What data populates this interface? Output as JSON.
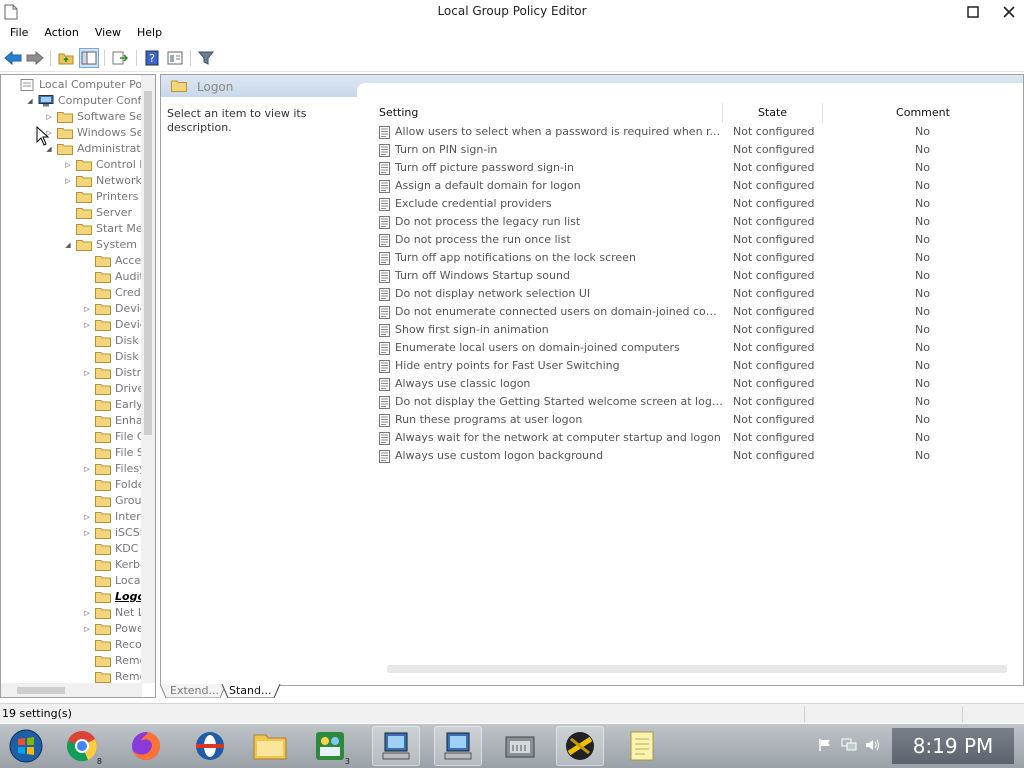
{
  "window": {
    "title": "Local Group Policy Editor",
    "maximize_glyph": "☐",
    "close_glyph": "✕"
  },
  "menu": [
    "File",
    "Action",
    "View",
    "Help"
  ],
  "toolbar": {
    "icons": [
      "back-arrow-icon",
      "forward-arrow-icon",
      "up-folder-icon",
      "show-hide-tree-icon",
      "export-list-icon",
      "help-icon",
      "properties-icon",
      "filter-icon"
    ]
  },
  "tree": {
    "nodes": [
      {
        "label": "Local Computer Polic",
        "indent": 0,
        "arrow": "",
        "icon": "policy"
      },
      {
        "label": "Computer Configu",
        "indent": 1,
        "arrow": "◢",
        "icon": "computer"
      },
      {
        "label": "Software Setti",
        "indent": 2,
        "arrow": "▷",
        "icon": "folder"
      },
      {
        "label": "Windows Setti",
        "indent": 2,
        "arrow": "▷",
        "icon": "folder"
      },
      {
        "label": "Administrative",
        "indent": 2,
        "arrow": "◢",
        "icon": "folder"
      },
      {
        "label": "Control Pa",
        "indent": 3,
        "arrow": "▷",
        "icon": "folder"
      },
      {
        "label": "Network",
        "indent": 3,
        "arrow": "▷",
        "icon": "folder"
      },
      {
        "label": "Printers",
        "indent": 3,
        "arrow": "",
        "icon": "folder"
      },
      {
        "label": "Server",
        "indent": 3,
        "arrow": "",
        "icon": "folder"
      },
      {
        "label": "Start Menu",
        "indent": 3,
        "arrow": "",
        "icon": "folder"
      },
      {
        "label": "System",
        "indent": 3,
        "arrow": "◢",
        "icon": "folder"
      },
      {
        "label": "Access",
        "indent": 4,
        "arrow": "",
        "icon": "folder"
      },
      {
        "label": "Audit P",
        "indent": 4,
        "arrow": "",
        "icon": "folder"
      },
      {
        "label": "Creden",
        "indent": 4,
        "arrow": "",
        "icon": "folder"
      },
      {
        "label": "Device",
        "indent": 4,
        "arrow": "▷",
        "icon": "folder"
      },
      {
        "label": "Device",
        "indent": 4,
        "arrow": "▷",
        "icon": "folder"
      },
      {
        "label": "Disk N\\",
        "indent": 4,
        "arrow": "",
        "icon": "folder"
      },
      {
        "label": "Disk Q",
        "indent": 4,
        "arrow": "",
        "icon": "folder"
      },
      {
        "label": "Distrib",
        "indent": 4,
        "arrow": "▷",
        "icon": "folder"
      },
      {
        "label": "Driver I",
        "indent": 4,
        "arrow": "",
        "icon": "folder"
      },
      {
        "label": "Early La",
        "indent": 4,
        "arrow": "",
        "icon": "folder"
      },
      {
        "label": "Enhanc",
        "indent": 4,
        "arrow": "",
        "icon": "folder"
      },
      {
        "label": "File Cla",
        "indent": 4,
        "arrow": "",
        "icon": "folder"
      },
      {
        "label": "File Sh",
        "indent": 4,
        "arrow": "",
        "icon": "folder"
      },
      {
        "label": "Filesys",
        "indent": 4,
        "arrow": "▷",
        "icon": "folder"
      },
      {
        "label": "Folder",
        "indent": 4,
        "arrow": "",
        "icon": "folder"
      },
      {
        "label": "Group",
        "indent": 4,
        "arrow": "",
        "icon": "folder"
      },
      {
        "label": "Interne",
        "indent": 4,
        "arrow": "▷",
        "icon": "folder"
      },
      {
        "label": "iSCSI",
        "indent": 4,
        "arrow": "▷",
        "icon": "folder"
      },
      {
        "label": "KDC",
        "indent": 4,
        "arrow": "",
        "icon": "folder"
      },
      {
        "label": "Kerbero",
        "indent": 4,
        "arrow": "",
        "icon": "folder"
      },
      {
        "label": "Locale",
        "indent": 4,
        "arrow": "",
        "icon": "folder"
      },
      {
        "label": "Logon",
        "indent": 4,
        "arrow": "",
        "icon": "folder",
        "selected": true
      },
      {
        "label": "Net Log",
        "indent": 4,
        "arrow": "▷",
        "icon": "folder"
      },
      {
        "label": "Power",
        "indent": 4,
        "arrow": "▷",
        "icon": "folder"
      },
      {
        "label": "Recove",
        "indent": 4,
        "arrow": "",
        "icon": "folder"
      },
      {
        "label": "Remote",
        "indent": 4,
        "arrow": "",
        "icon": "folder"
      },
      {
        "label": "Remote",
        "indent": 4,
        "arrow": "",
        "icon": "folder"
      }
    ]
  },
  "panel": {
    "header_title": "Logon",
    "description": "Select an item to view its description."
  },
  "columns": {
    "setting": "Setting",
    "state": "State",
    "comment": "Comment"
  },
  "settings": [
    {
      "name": "Allow users to select when a password is required when r...",
      "state": "Not configured",
      "comment": "No"
    },
    {
      "name": "Turn on PIN sign-in",
      "state": "Not configured",
      "comment": "No"
    },
    {
      "name": "Turn off picture password sign-in",
      "state": "Not configured",
      "comment": "No"
    },
    {
      "name": "Assign a default domain for logon",
      "state": "Not configured",
      "comment": "No"
    },
    {
      "name": "Exclude credential providers",
      "state": "Not configured",
      "comment": "No"
    },
    {
      "name": "Do not process the legacy run list",
      "state": "Not configured",
      "comment": "No"
    },
    {
      "name": "Do not process the run once list",
      "state": "Not configured",
      "comment": "No"
    },
    {
      "name": "Turn off app notifications on the lock screen",
      "state": "Not configured",
      "comment": "No"
    },
    {
      "name": "Turn off Windows Startup sound",
      "state": "Not configured",
      "comment": "No"
    },
    {
      "name": "Do not display network selection UI",
      "state": "Not configured",
      "comment": "No"
    },
    {
      "name": "Do not enumerate connected users on domain-joined com...",
      "state": "Not configured",
      "comment": "No"
    },
    {
      "name": "Show first sign-in animation",
      "state": "Not configured",
      "comment": "No"
    },
    {
      "name": "Enumerate local users on domain-joined computers",
      "state": "Not configured",
      "comment": "No"
    },
    {
      "name": "Hide entry points for Fast User Switching",
      "state": "Not configured",
      "comment": "No"
    },
    {
      "name": "Always use classic logon",
      "state": "Not configured",
      "comment": "No"
    },
    {
      "name": "Do not display the Getting Started welcome screen at logon",
      "state": "Not configured",
      "comment": "No"
    },
    {
      "name": "Run these programs at user logon",
      "state": "Not configured",
      "comment": "No"
    },
    {
      "name": "Always wait for the network at computer startup and logon",
      "state": "Not configured",
      "comment": "No"
    },
    {
      "name": "Always use custom logon background",
      "state": "Not configured",
      "comment": "No"
    }
  ],
  "tabs": [
    "Extend...",
    "Stand..."
  ],
  "status": {
    "text": "19 setting(s)"
  },
  "taskbar": {
    "items": [
      {
        "name": "start-orb-icon",
        "count": ""
      },
      {
        "name": "chrome-icon",
        "count": "8"
      },
      {
        "name": "firefox-icon",
        "count": ""
      },
      {
        "name": "opera-icon",
        "count": ""
      },
      {
        "name": "file-explorer-icon",
        "count": ""
      },
      {
        "name": "network-people-icon",
        "count": "3"
      },
      {
        "name": "remote-computer-icon",
        "count": ""
      },
      {
        "name": "remote-computer-2-icon",
        "count": ""
      },
      {
        "name": "device-icon",
        "count": ""
      },
      {
        "name": "media-icon",
        "count": ""
      },
      {
        "name": "notepad-icon",
        "count": ""
      }
    ],
    "clock": "8:19 PM"
  }
}
